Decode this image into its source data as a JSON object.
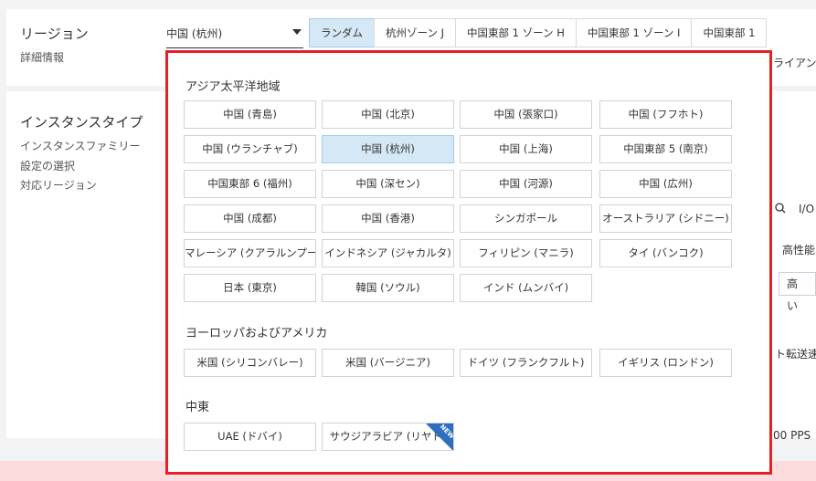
{
  "top": {
    "region_label": "リージョン",
    "detail_link": "詳細情報",
    "region_select_value": "中国 (杭州)",
    "zone_tabs": [
      "ランダム",
      "杭州ゾーン J",
      "中国東部 1 ゾーン H",
      "中国東部 1 ゾーン I",
      "中国東部 1"
    ]
  },
  "instance": {
    "title": "インスタンスタイプ",
    "sub_family": "インスタンスファミリー",
    "sub_selection": "設定の選択",
    "sub_regions": "対応リージョン"
  },
  "background_fragments": {
    "right_top": "ライアン",
    "io_label": "I/O",
    "perf_label": "高性能",
    "high_box": "高い",
    "transfer_text": "ト転送速",
    "pps_text": "00 PPS"
  },
  "popup": {
    "groups": [
      {
        "title": "アジア太平洋地域",
        "options": [
          "中国 (青島)",
          "中国 (北京)",
          "中国 (張家口)",
          "中国 (フフホト)",
          "中国 (ウランチャブ)",
          "中国 (杭州)",
          "中国 (上海)",
          "中国東部 5 (南京)",
          "中国東部 6 (福州)",
          "中国 (深セン)",
          "中国 (河源)",
          "中国 (広州)",
          "中国 (成都)",
          "中国 (香港)",
          "シンガポール",
          "オーストラリア (シドニー)",
          "マレーシア (クアラルンプール)",
          "インドネシア (ジャカルタ)",
          "フィリピン (マニラ)",
          "タイ (バンコク)",
          "日本 (東京)",
          "韓国 (ソウル)",
          "インド (ムンバイ)"
        ]
      },
      {
        "title": "ヨーロッパおよびアメリカ",
        "options": [
          "米国 (シリコンバレー)",
          "米国 (バージニア)",
          "ドイツ (フランクフルト)",
          "イギリス (ロンドン)"
        ]
      },
      {
        "title": "中東",
        "options": [
          "UAE (ドバイ)",
          "サウジアラビア (リヤド)"
        ]
      }
    ],
    "selected_option": "中国 (杭州)",
    "new_badge": "NEW",
    "accent_color": "#e32127"
  }
}
